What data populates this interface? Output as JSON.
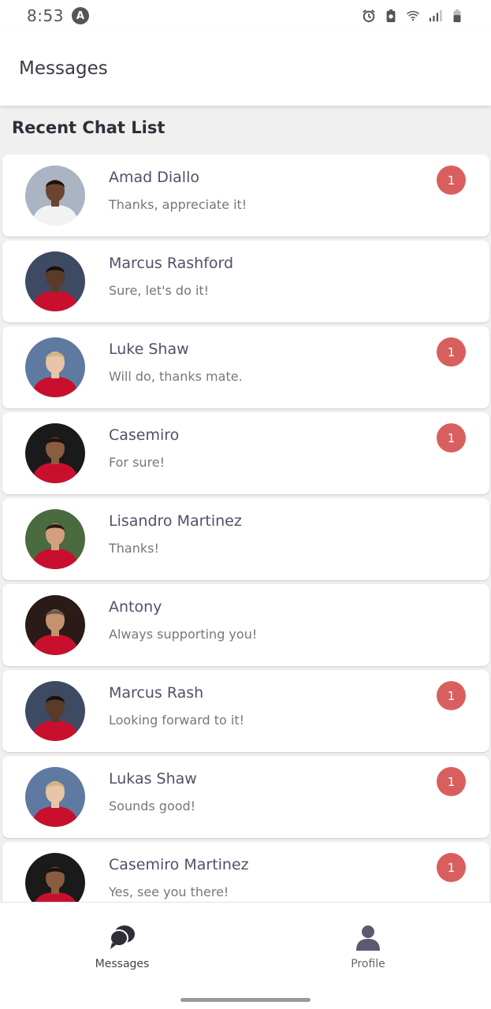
{
  "status_bar": {
    "time": "8:53",
    "app_icon_letter": "A",
    "icons": [
      "alarm-icon",
      "battery-saver-icon",
      "wifi-icon",
      "signal-icon",
      "battery-icon"
    ]
  },
  "header": {
    "title": "Messages"
  },
  "section": {
    "title": "Recent Chat List"
  },
  "colors": {
    "badge": "#d95f5f",
    "jersey_red": "#c8102e",
    "nav_icon": "#2e2e3a"
  },
  "chats": [
    {
      "name": "Amad Diallo",
      "message": "Thanks, appreciate it!",
      "unread": "1",
      "jersey": "white"
    },
    {
      "name": "Marcus Rashford",
      "message": "Sure, let's do it!",
      "unread": "",
      "jersey": "red"
    },
    {
      "name": "Luke Shaw",
      "message": "Will do, thanks mate.",
      "unread": "1",
      "jersey": "red"
    },
    {
      "name": "Casemiro",
      "message": "For sure!",
      "unread": "1",
      "jersey": "red"
    },
    {
      "name": "Lisandro Martinez",
      "message": "Thanks!",
      "unread": "",
      "jersey": "red"
    },
    {
      "name": "Antony",
      "message": "Always supporting you!",
      "unread": "",
      "jersey": "red"
    },
    {
      "name": "Marcus Rash",
      "message": "Looking forward to it!",
      "unread": "1",
      "jersey": "red"
    },
    {
      "name": "Lukas Shaw",
      "message": "Sounds good!",
      "unread": "1",
      "jersey": "red"
    },
    {
      "name": "Casemiro Martinez",
      "message": "Yes, see you there!",
      "unread": "1",
      "jersey": "red"
    }
  ],
  "bottom_nav": {
    "items": [
      {
        "label": "Messages",
        "icon": "chat-bubbles-icon",
        "active": true
      },
      {
        "label": "Profile",
        "icon": "person-icon",
        "active": false
      }
    ]
  }
}
